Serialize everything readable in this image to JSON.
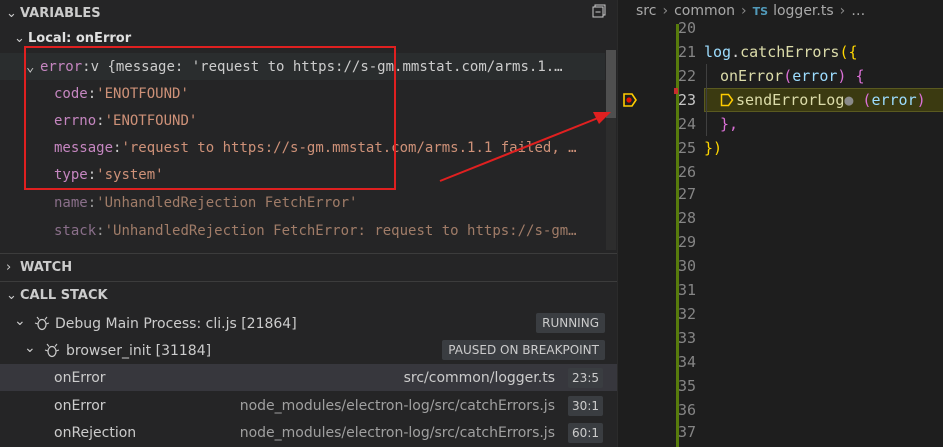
{
  "sidebar": {
    "variables_header": "VARIABLES",
    "scope_label": "Local: onError",
    "variables": [
      {
        "key": "error",
        "sep": ": ",
        "value": "v {message: 'request to https://s-gm.mmstat.com/arms.1.…"
      },
      {
        "key": "code",
        "sep": ": ",
        "value": "'ENOTFOUND'"
      },
      {
        "key": "errno",
        "sep": ": ",
        "value": "'ENOTFOUND'"
      },
      {
        "key": "message",
        "sep": ": ",
        "value": "'request to https://s-gm.mmstat.com/arms.1.1 failed, …"
      },
      {
        "key": "type",
        "sep": ": ",
        "value": "'system'"
      },
      {
        "key": "name",
        "sep": ": ",
        "value": "'UnhandledRejection FetchError'"
      },
      {
        "key": "stack",
        "sep": ": ",
        "value": "'UnhandledRejection FetchError: request to https://s-gm…"
      }
    ],
    "watch_header": "WATCH",
    "callstack_header": "CALL STACK",
    "processes": [
      {
        "label": "Debug Main Process: cli.js [21864]",
        "badge": "RUNNING"
      },
      {
        "label": "browser_init [31184]",
        "badge": "PAUSED ON BREAKPOINT"
      }
    ],
    "frames": [
      {
        "name": "onError",
        "file": "src/common/logger.ts",
        "pos": "23:5"
      },
      {
        "name": "onError",
        "file": "node_modules/electron-log/src/catchErrors.js",
        "pos": "30:1"
      },
      {
        "name": "onRejection",
        "file": "node_modules/electron-log/src/catchErrors.js",
        "pos": "60:1"
      }
    ]
  },
  "editor": {
    "breadcrumb": {
      "part1": "src",
      "part2": "common",
      "lang_badge": "TS",
      "file": "logger.ts",
      "more": "…"
    },
    "lines": [
      {
        "num": "20"
      },
      {
        "num": "21",
        "t1": "log",
        "t2": ".",
        "t3": "catchErrors",
        "t4": "({"
      },
      {
        "num": "22",
        "t1": "onError",
        "t2": "(",
        "t3": "error",
        "t4": ") {"
      },
      {
        "num": "23",
        "t1": "sendErrorLog",
        "t2": " (",
        "t3": "error",
        "t4": ")"
      },
      {
        "num": "24",
        "t1": "},"
      },
      {
        "num": "25",
        "t1": "})"
      },
      {
        "num": "26"
      },
      {
        "num": "27"
      },
      {
        "num": "28"
      },
      {
        "num": "29"
      },
      {
        "num": "30"
      },
      {
        "num": "31"
      },
      {
        "num": "32"
      },
      {
        "num": "33"
      },
      {
        "num": "34"
      },
      {
        "num": "35"
      },
      {
        "num": "36"
      },
      {
        "num": "37"
      }
    ]
  },
  "annotation": {
    "color": "#e02020"
  }
}
